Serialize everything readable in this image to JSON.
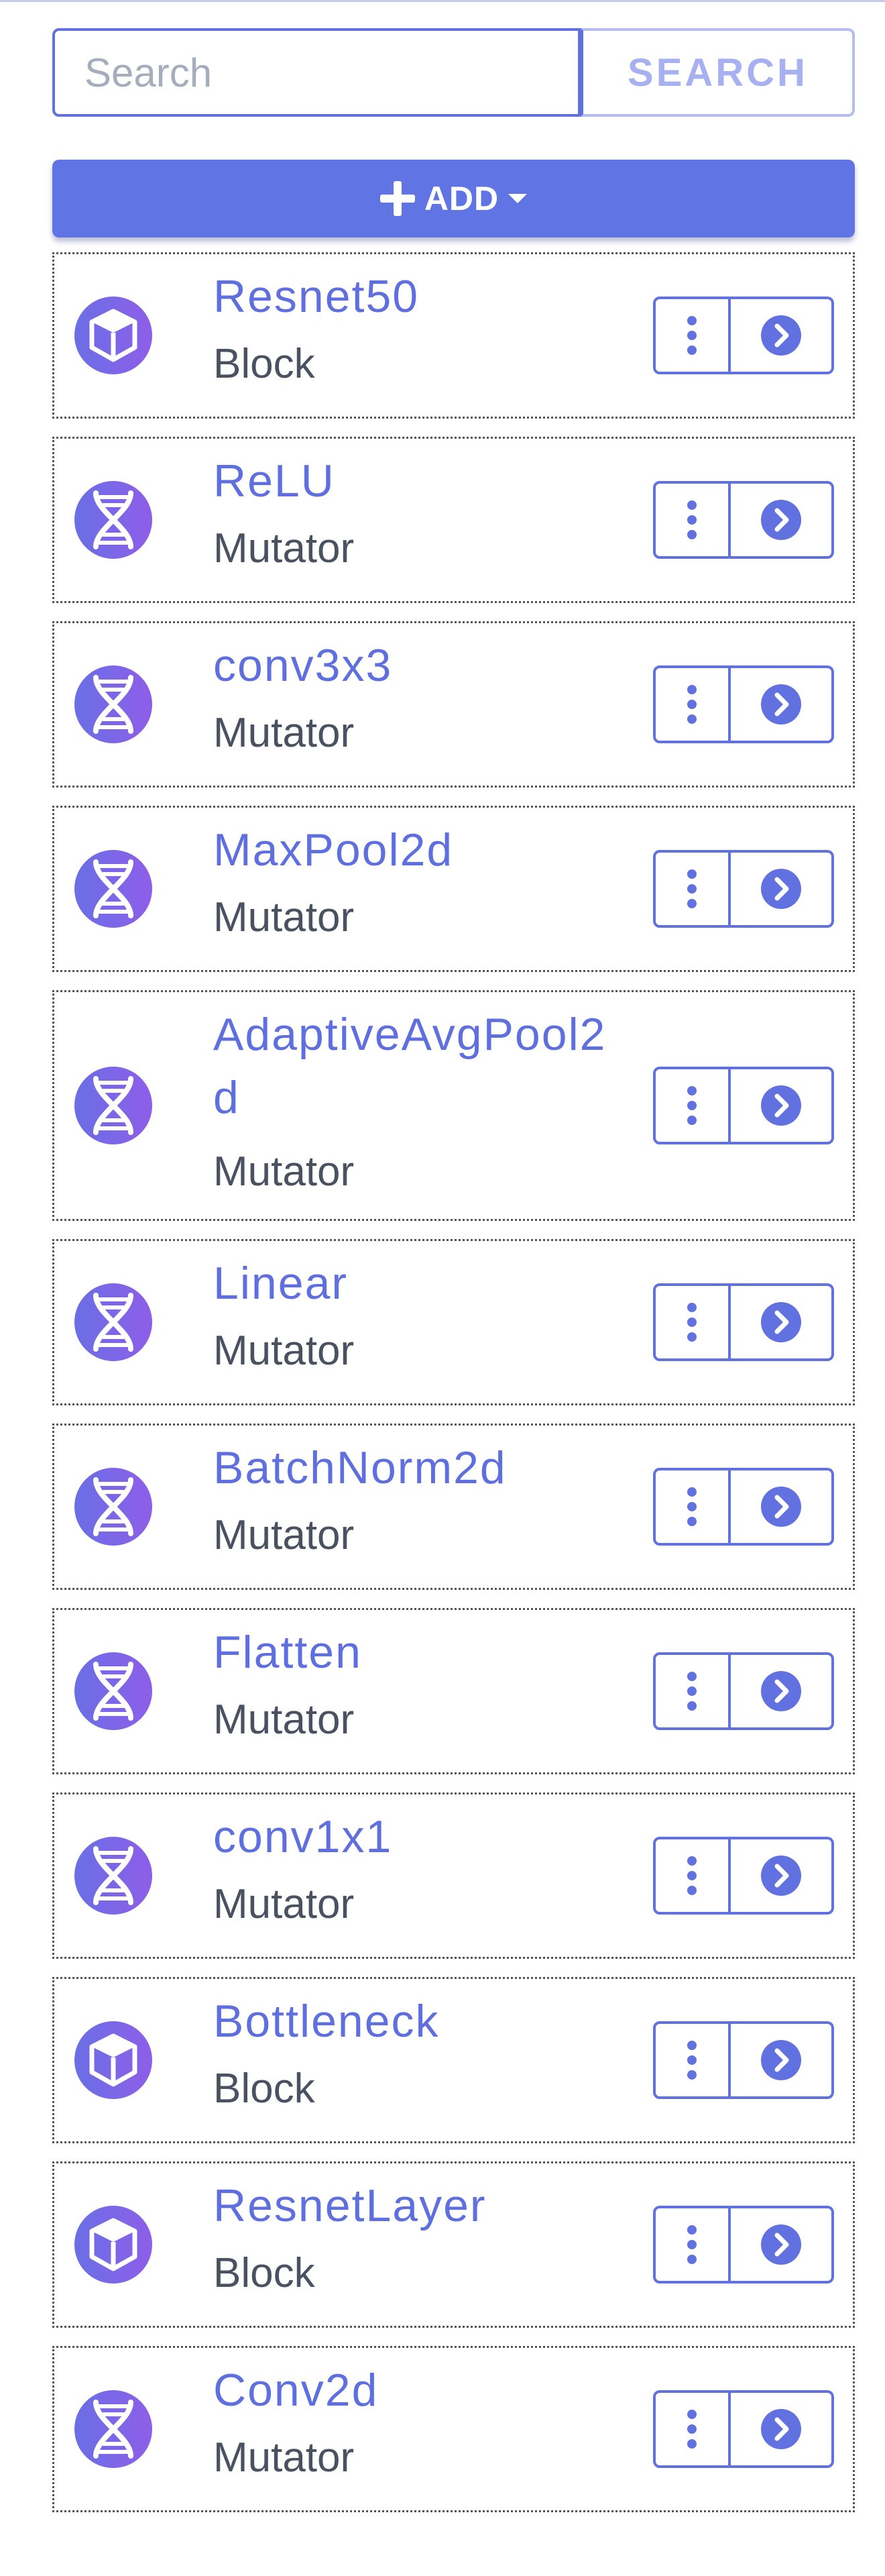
{
  "search": {
    "placeholder": "Search",
    "value": "",
    "button_label": "SEARCH"
  },
  "add": {
    "label": "ADD",
    "icon": "plus-icon",
    "caret": "caret-down-icon"
  },
  "colors": {
    "accent": "#6174e3",
    "link": "#5f6fe0",
    "kind_text": "#4a5262",
    "icon_gradient_start": "#6a6fe6",
    "icon_gradient_end": "#8e5ee8"
  },
  "items": [
    {
      "title": "Resnet50",
      "kind": "Block",
      "icon": "cube-icon"
    },
    {
      "title": "ReLU",
      "kind": "Mutator",
      "icon": "dna-icon"
    },
    {
      "title": "conv3x3",
      "kind": "Mutator",
      "icon": "dna-icon"
    },
    {
      "title": "MaxPool2d",
      "kind": "Mutator",
      "icon": "dna-icon"
    },
    {
      "title": "AdaptiveAvgPool2d",
      "kind": "Mutator",
      "icon": "dna-icon"
    },
    {
      "title": "Linear",
      "kind": "Mutator",
      "icon": "dna-icon"
    },
    {
      "title": "BatchNorm2d",
      "kind": "Mutator",
      "icon": "dna-icon"
    },
    {
      "title": "Flatten",
      "kind": "Mutator",
      "icon": "dna-icon"
    },
    {
      "title": "conv1x1",
      "kind": "Mutator",
      "icon": "dna-icon"
    },
    {
      "title": "Bottleneck",
      "kind": "Block",
      "icon": "cube-icon"
    },
    {
      "title": "ResnetLayer",
      "kind": "Block",
      "icon": "cube-icon"
    },
    {
      "title": "Conv2d",
      "kind": "Mutator",
      "icon": "dna-icon"
    }
  ]
}
